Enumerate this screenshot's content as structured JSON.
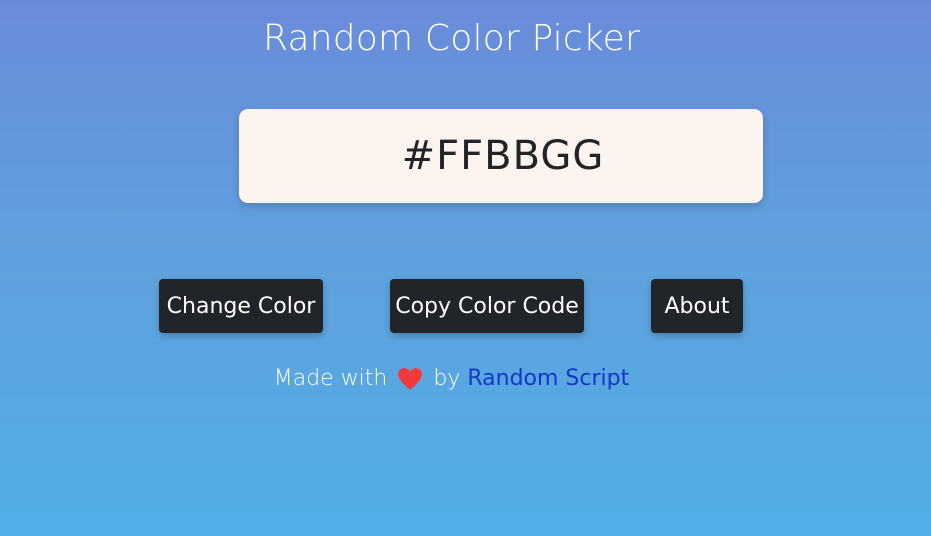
{
  "header": {
    "title": "Random Color Picker"
  },
  "display": {
    "color_code": "#FFBBGG",
    "box_color": "#fdf3ef"
  },
  "actions": {
    "change_label": "Change Color",
    "copy_label": "Copy Color Code",
    "about_label": "About"
  },
  "footer": {
    "made_with": "Made with",
    "heart_icon": "heart-icon",
    "by": "by",
    "author_link": "Random Script",
    "heart_color": "#f23a3a",
    "link_color": "#1238c9"
  }
}
